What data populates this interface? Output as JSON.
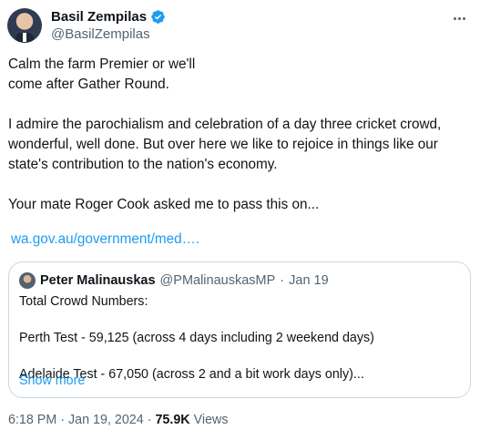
{
  "author": {
    "display_name": "Basil Zempilas",
    "handle": "@BasilZempilas",
    "verified_color": "#1d9bf0"
  },
  "tweet": {
    "paragraphs": [
      "Calm the farm Premier or we'll",
      "come after Gather Round.",
      "",
      "I admire the parochialism and celebration of a day three cricket crowd,",
      "wonderful, well done. But over here we like to rejoice in things like our",
      "state's contribution to the nation's economy.",
      "",
      "Your mate Roger Cook asked me to pass this on..."
    ],
    "link_text": "wa.gov.au/government/med…."
  },
  "quote": {
    "name": "Peter Malinauskas",
    "handle": "@PMalinauskasMP",
    "separator": "·",
    "date": "Jan 19",
    "lines": [
      "Total Crowd Numbers:",
      "",
      "Perth Test - 59,125 (across 4 days including 2 weekend days)",
      "",
      "Adelaide Test - 67,050 (across 2 and a bit work days only)..."
    ],
    "show_more": "Show more"
  },
  "footer": {
    "time": "6:18 PM",
    "separator": "·",
    "date": "Jan 19, 2024",
    "separator2": "·",
    "views_count": "75.9K",
    "views_label": "Views"
  },
  "colors": {
    "link": "#1d9bf0",
    "muted": "#536471",
    "text": "#0f1419",
    "border": "#cfd9de"
  }
}
